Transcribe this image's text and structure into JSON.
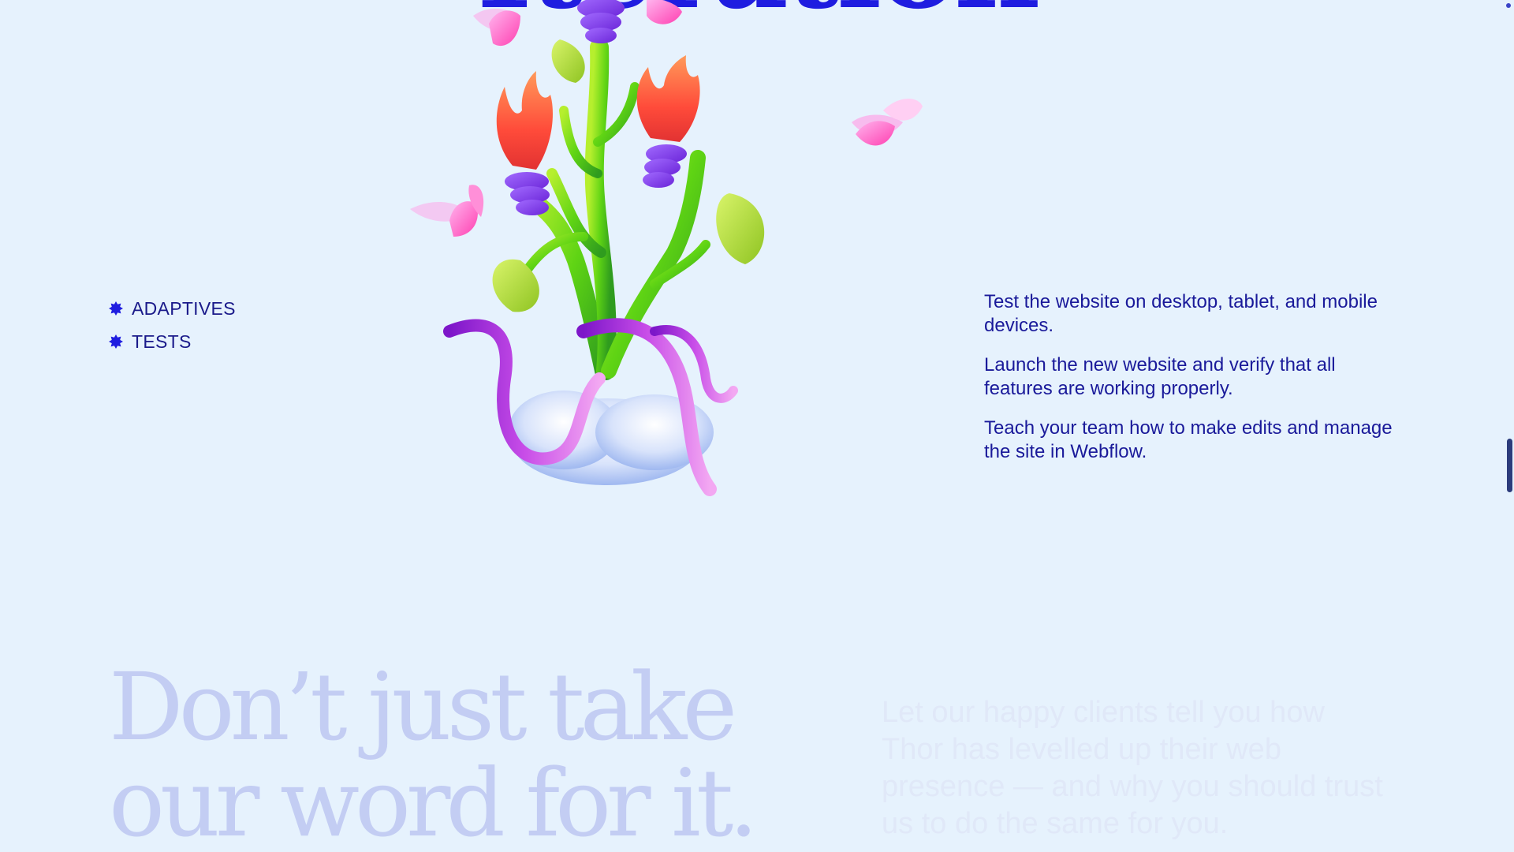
{
  "top_heading": "Iteration",
  "tags": [
    {
      "label": "ADAPTIVES",
      "icon": "starburst-bullet-icon"
    },
    {
      "label": "TESTS",
      "icon": "starburst-bullet-icon"
    }
  ],
  "steps": [
    "Test the website on desktop, tablet, and mobile devices.",
    "Launch the new website and verify that all features are working properly.",
    "Teach your team how to make edits and manage the site in Webflow."
  ],
  "testimonial": {
    "heading_line1": "Don’t just take",
    "heading_line2": "our word for it.",
    "subtext": "Let our happy clients tell you how Thor has levelled up their web presence — and why you should trust us to do the same for you."
  },
  "colors": {
    "background": "#e6f2fd",
    "accent": "#1f1de0",
    "text": "#1a1a9a",
    "faded_heading": "#c3cdf3"
  },
  "scroll": {
    "position_fraction": 0.55
  }
}
